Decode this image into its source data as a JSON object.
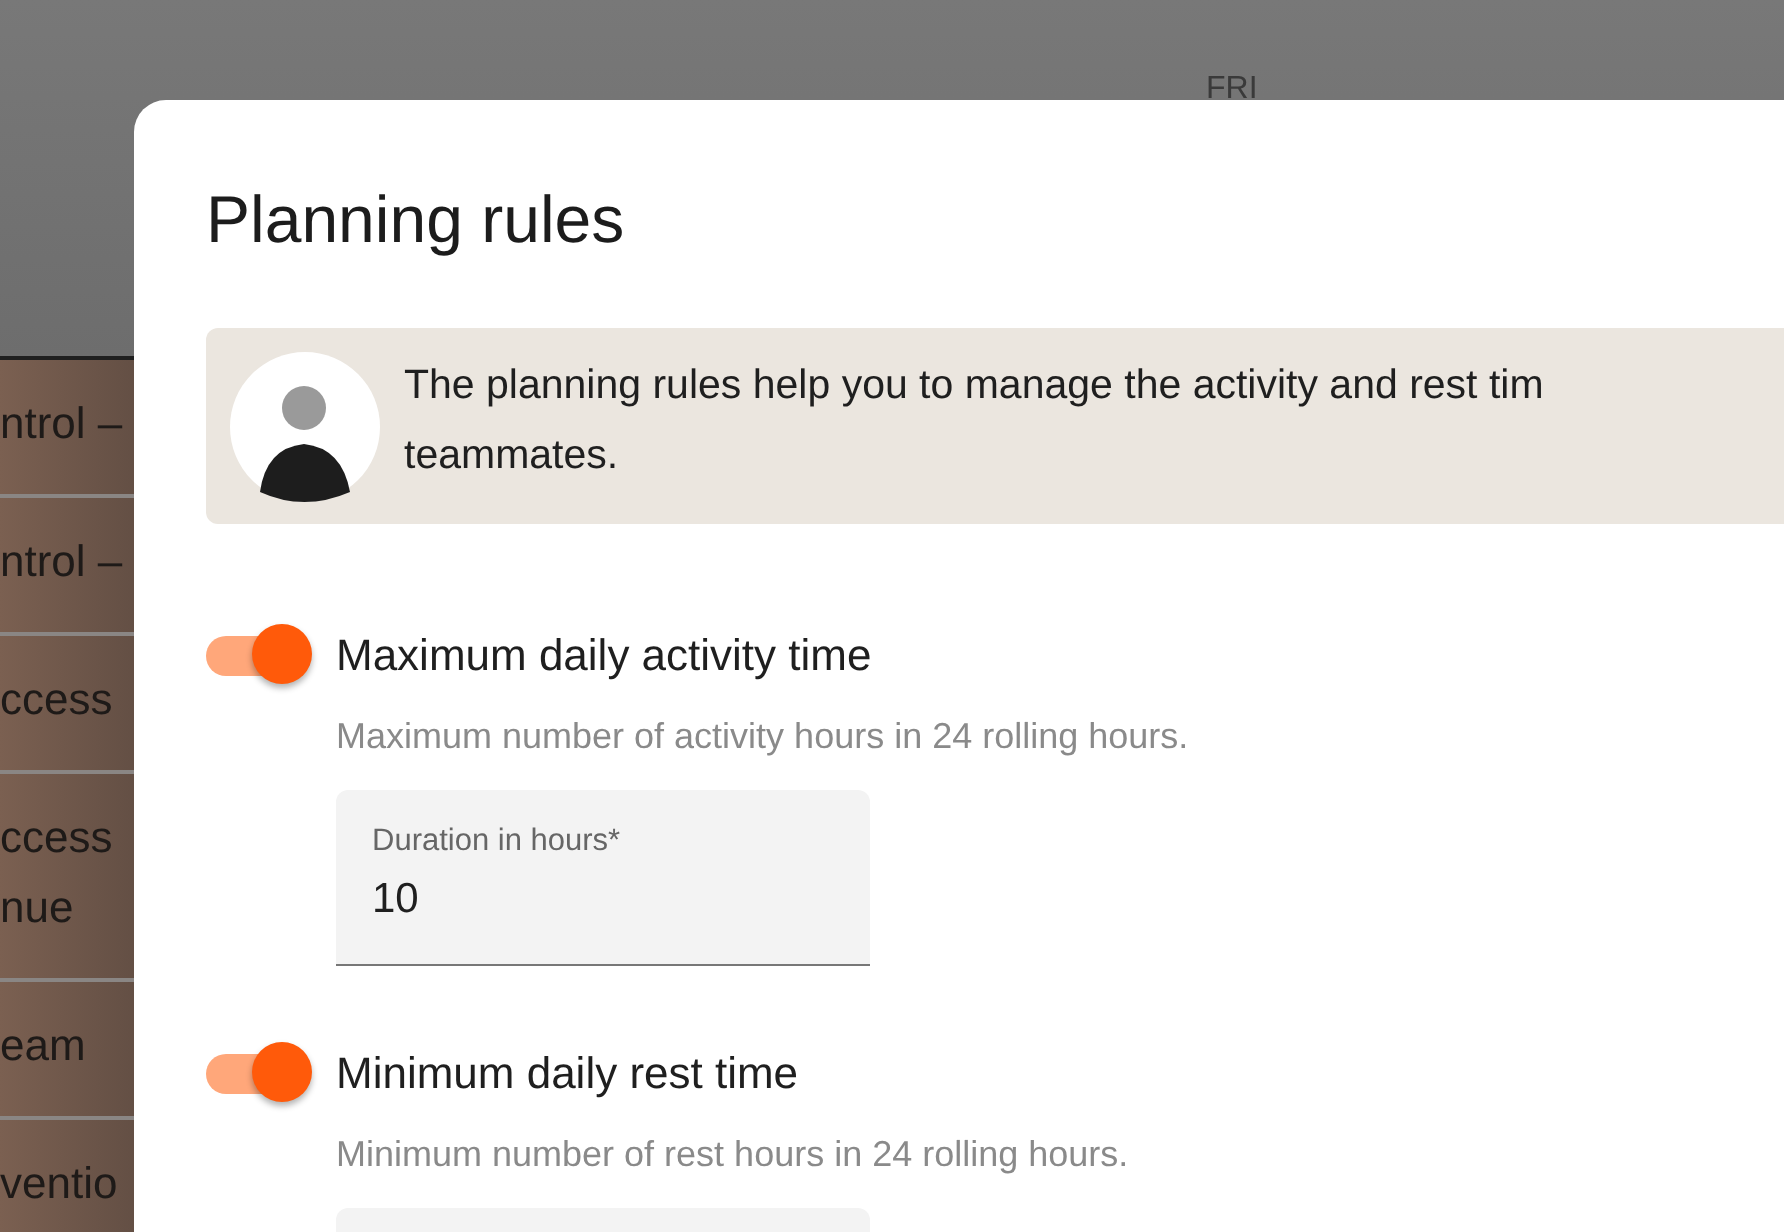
{
  "background": {
    "day_label": "FRI",
    "rows": [
      {
        "lines": [
          "ntrol –"
        ]
      },
      {
        "lines": [
          "ntrol –"
        ]
      },
      {
        "lines": [
          "ccess"
        ]
      },
      {
        "lines": [
          "ccess",
          "nue"
        ]
      },
      {
        "lines": [
          "eam"
        ]
      },
      {
        "lines": [
          "ventio"
        ]
      }
    ]
  },
  "dialog": {
    "title": "Planning rules",
    "banner": {
      "lines": [
        "The planning rules help you to manage the activity and rest tim",
        "teammates."
      ]
    },
    "rules": [
      {
        "title": "Maximum daily activity time",
        "description": "Maximum number of activity hours in 24 rolling hours.",
        "on": true,
        "field": {
          "label": "Duration in hours*",
          "value": "10"
        }
      },
      {
        "title": "Minimum daily rest time",
        "description": "Minimum number of rest hours in 24 rolling hours.",
        "on": true
      }
    ]
  }
}
